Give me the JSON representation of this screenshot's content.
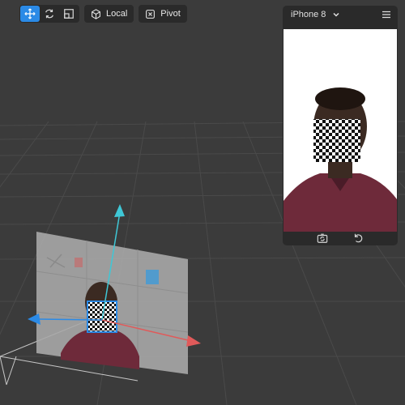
{
  "toolbar": {
    "tools": [
      {
        "name": "move",
        "icon": "move-icon",
        "active": true
      },
      {
        "name": "rotate",
        "icon": "rotate-icon",
        "active": false
      },
      {
        "name": "scale",
        "icon": "scale-icon",
        "active": false
      }
    ],
    "space_label": "Local",
    "space_icon": "cube-icon",
    "pivot_label": "Pivot",
    "pivot_icon": "pivot-icon"
  },
  "preview": {
    "device_label": "iPhone 8",
    "dropdown_icon": "chevron-down-icon",
    "menu_icon": "hamburger-menu-icon",
    "footer_icons": [
      "switch-camera-icon",
      "reset-icon"
    ]
  },
  "colors": {
    "background": "#3b3b3b",
    "panel": "#2a2a2a",
    "accent": "#2b8ae6",
    "gizmo_x": "#e05a5a",
    "gizmo_y": "#3fc7d6",
    "gizmo_z": "#2b8ae6"
  }
}
